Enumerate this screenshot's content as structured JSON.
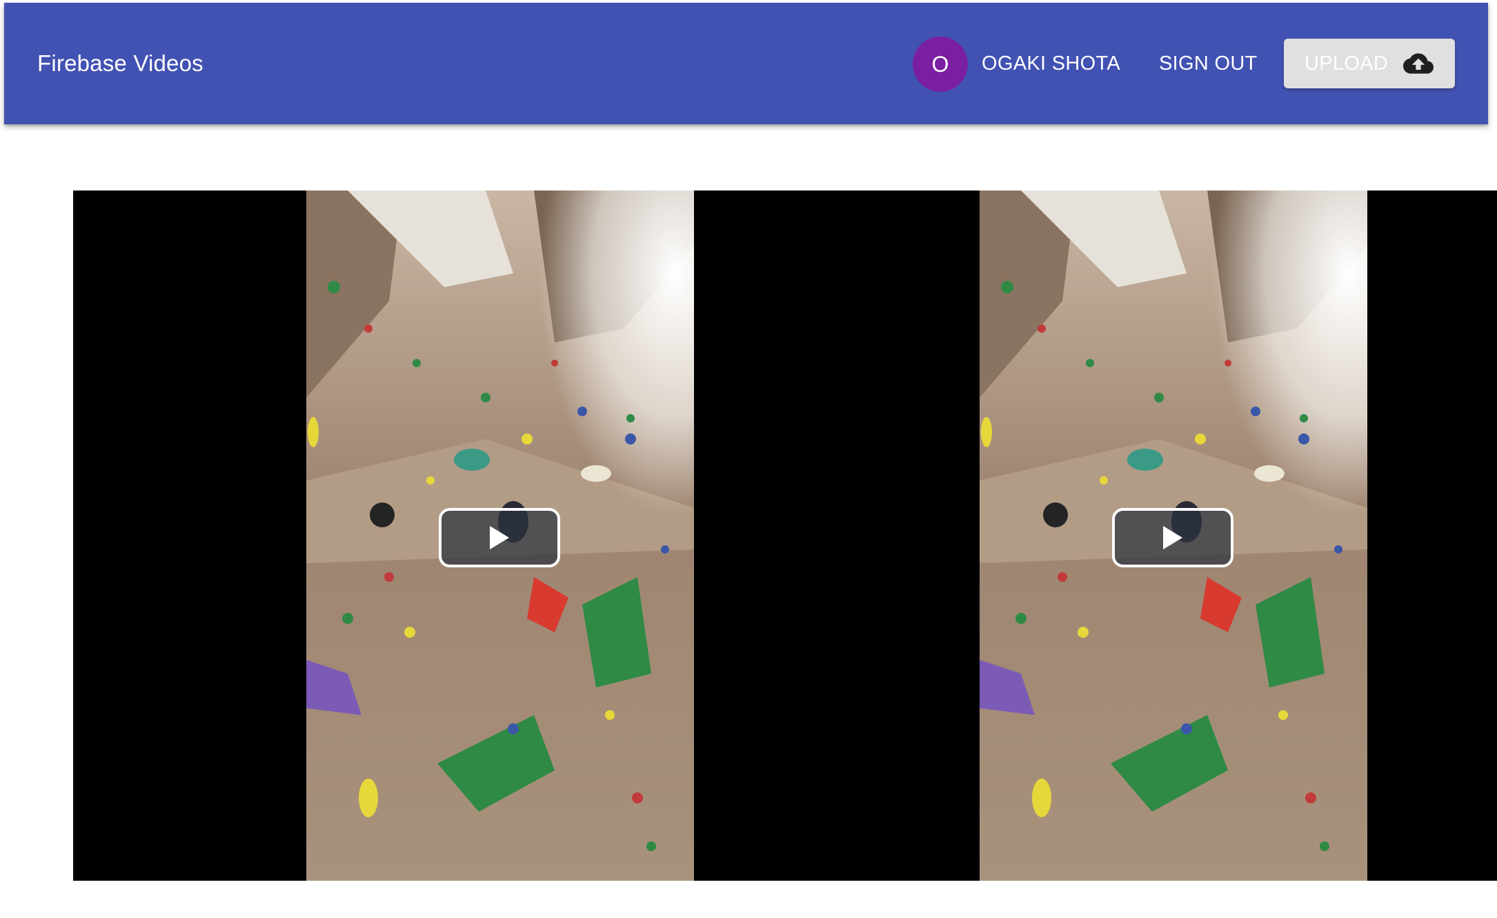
{
  "appbar": {
    "title": "Firebase Videos",
    "background": "#4252b2"
  },
  "user": {
    "avatar_initial": "O",
    "avatar_color": "#7b1fa2",
    "name": "OGAKI SHOTA"
  },
  "actions": {
    "sign_out_label": "SIGN OUT",
    "upload_label": "UPLOAD",
    "upload_icon": "cloud-upload-icon"
  },
  "videos": [
    {
      "thumbnail": "indoor-climbing-wall",
      "play_icon": "play-icon"
    },
    {
      "thumbnail": "indoor-climbing-wall",
      "play_icon": "play-icon"
    }
  ]
}
